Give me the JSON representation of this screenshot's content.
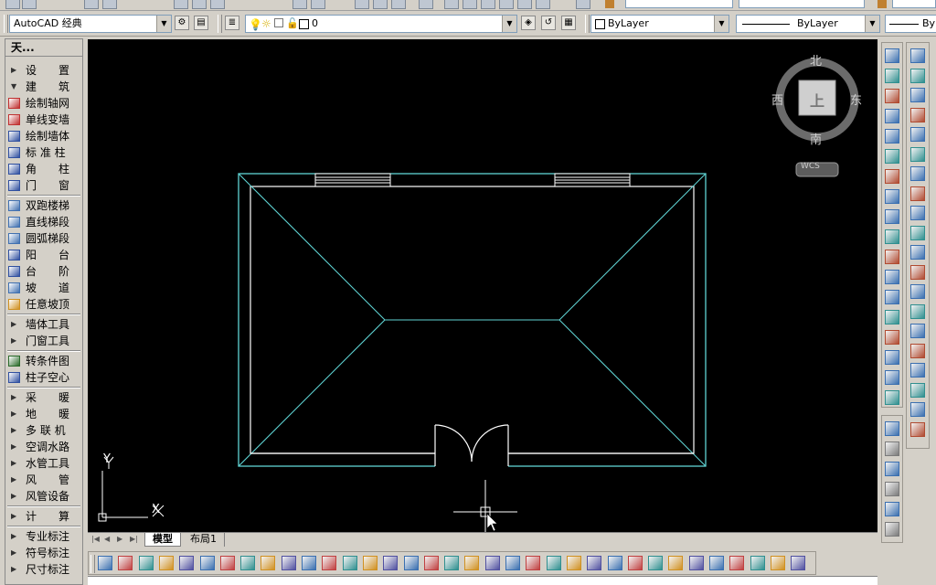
{
  "workspace": {
    "selected": "AutoCAD 经典"
  },
  "layer": {
    "current": "0"
  },
  "properties": {
    "color": "ByLayer",
    "linetype": "ByLayer",
    "lineweight": "By"
  },
  "palette": {
    "title": "天...",
    "items": [
      {
        "label": "设　　置",
        "kind": "collapsed"
      },
      {
        "label": "建　　筑",
        "kind": "expanded"
      },
      {
        "label": "绘制轴网",
        "kind": "tool",
        "icon": "axis-grid-icon"
      },
      {
        "label": "单线变墙",
        "kind": "tool",
        "icon": "line-to-wall-icon"
      },
      {
        "label": "绘制墙体",
        "kind": "tool",
        "icon": "draw-wall-icon"
      },
      {
        "label": "标 准 柱",
        "kind": "tool",
        "icon": "standard-column-icon"
      },
      {
        "label": "角　　柱",
        "kind": "tool",
        "icon": "corner-column-icon"
      },
      {
        "label": "门　　窗",
        "kind": "tool",
        "icon": "door-window-icon"
      },
      {
        "label": "双跑楼梯",
        "kind": "tool",
        "icon": "double-stair-icon"
      },
      {
        "label": "直线梯段",
        "kind": "tool",
        "icon": "straight-stair-icon"
      },
      {
        "label": "圆弧梯段",
        "kind": "tool",
        "icon": "arc-stair-icon"
      },
      {
        "label": "阳　　台",
        "kind": "tool",
        "icon": "balcony-icon"
      },
      {
        "label": "台　　阶",
        "kind": "tool",
        "icon": "steps-icon"
      },
      {
        "label": "坡　　道",
        "kind": "tool",
        "icon": "ramp-icon"
      },
      {
        "label": "任意坡顶",
        "kind": "tool",
        "icon": "roof-icon"
      },
      {
        "label": "墙体工具",
        "kind": "collapsed"
      },
      {
        "label": "门窗工具",
        "kind": "collapsed"
      },
      {
        "label": "转条件图",
        "kind": "tool",
        "icon": "convert-drawing-icon"
      },
      {
        "label": "柱子空心",
        "kind": "tool",
        "icon": "hollow-column-icon"
      },
      {
        "label": "采　　暖",
        "kind": "collapsed"
      },
      {
        "label": "地　　暖",
        "kind": "collapsed"
      },
      {
        "label": "多 联 机",
        "kind": "collapsed"
      },
      {
        "label": "空调水路",
        "kind": "collapsed"
      },
      {
        "label": "水管工具",
        "kind": "collapsed"
      },
      {
        "label": "风　　管",
        "kind": "collapsed"
      },
      {
        "label": "风管设备",
        "kind": "collapsed"
      },
      {
        "label": "计　　算",
        "kind": "collapsed"
      },
      {
        "label": "专业标注",
        "kind": "collapsed"
      },
      {
        "label": "符号标注",
        "kind": "collapsed"
      },
      {
        "label": "尺寸标注",
        "kind": "collapsed"
      }
    ]
  },
  "viewcube": {
    "north": "北",
    "south": "南",
    "east": "东",
    "west": "西",
    "face": "上",
    "wcs": "WCS"
  },
  "ucs": {
    "y_label": "Y",
    "x_label": "X"
  },
  "tabs": {
    "model": "模型",
    "layout1": "布局1"
  },
  "command": {
    "text": ""
  },
  "colors": {
    "canvas": "#000000",
    "geometry": "#5fd3d3",
    "white_lines": "#ffffff",
    "ui_face": "#d4d0c8"
  }
}
